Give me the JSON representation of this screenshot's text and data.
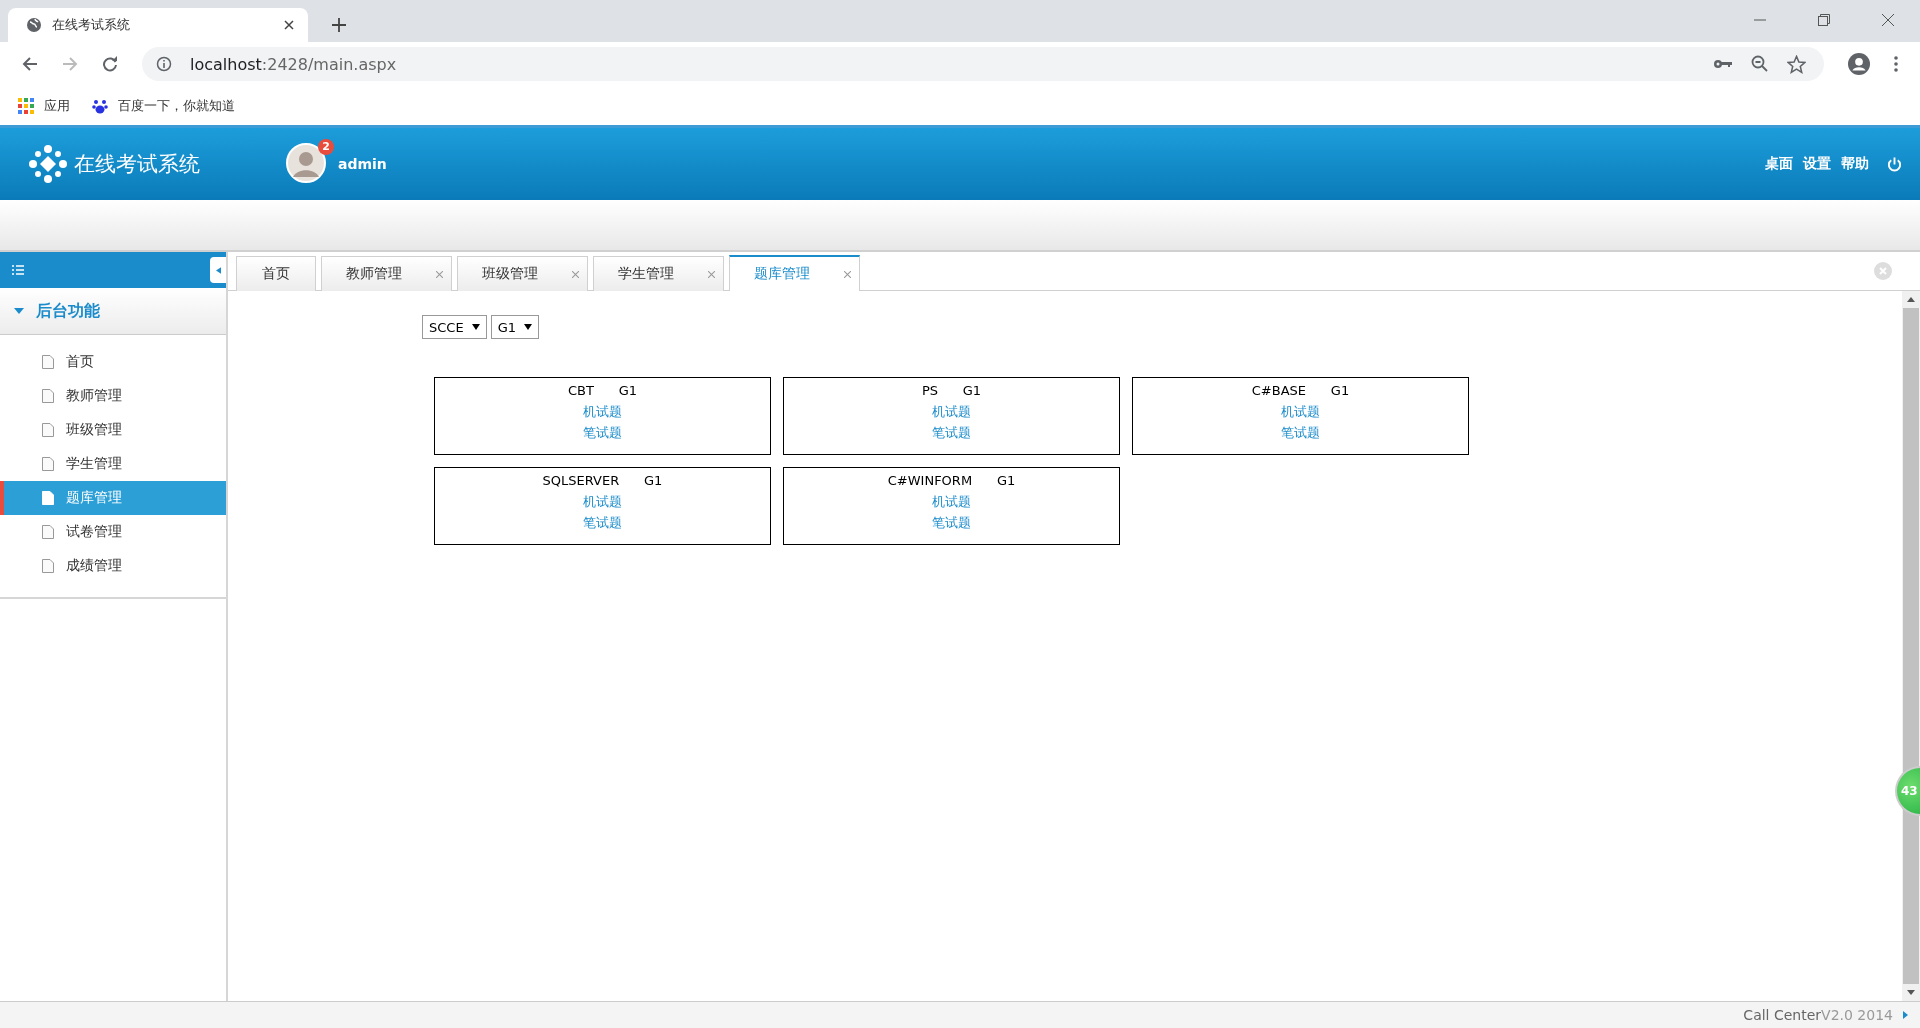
{
  "browser": {
    "tab_title": "在线考试系统",
    "url_host": "localhost",
    "url_rest": ":2428/main.aspx",
    "bookmarks": [
      {
        "kind": "apps",
        "label": "应用"
      },
      {
        "kind": "baidu",
        "label": "百度一下，你就知道"
      }
    ]
  },
  "header": {
    "app_title": "在线考试系统",
    "user": {
      "name": "admin",
      "badge": "2"
    },
    "links": [
      "桌面",
      "设置",
      "帮助"
    ]
  },
  "sidebar": {
    "section": {
      "label": "后台功能",
      "expanded": true
    },
    "items": [
      {
        "label": "首页",
        "selected": false
      },
      {
        "label": "教师管理",
        "selected": false
      },
      {
        "label": "班级管理",
        "selected": false
      },
      {
        "label": "学生管理",
        "selected": false
      },
      {
        "label": "题库管理",
        "selected": true
      },
      {
        "label": "试卷管理",
        "selected": false
      },
      {
        "label": "成绩管理",
        "selected": false
      }
    ]
  },
  "tabs": [
    {
      "label": "首页",
      "selected": false,
      "closable": false
    },
    {
      "label": "教师管理",
      "selected": false,
      "closable": true
    },
    {
      "label": "班级管理",
      "selected": false,
      "closable": true
    },
    {
      "label": "学生管理",
      "selected": false,
      "closable": true
    },
    {
      "label": "题库管理",
      "selected": true,
      "closable": true
    }
  ],
  "filters": [
    {
      "value": "SCCE"
    },
    {
      "value": "G1"
    }
  ],
  "cards": [
    {
      "subject": "CBT",
      "grade": "G1",
      "links": [
        "机试题",
        "笔试题"
      ]
    },
    {
      "subject": "PS",
      "grade": "G1",
      "links": [
        "机试题",
        "笔试题"
      ]
    },
    {
      "subject": "C#BASE",
      "grade": "G1",
      "links": [
        "机试题",
        "笔试题"
      ]
    },
    {
      "subject": "SQLSERVER",
      "grade": "G1",
      "links": [
        "机试题",
        "笔试题"
      ]
    },
    {
      "subject": "C#WINFORM",
      "grade": "G1",
      "links": [
        "机试题",
        "笔试题"
      ]
    }
  ],
  "floating_ball": "43",
  "footer": {
    "product": "Call Center",
    "version": "V2.0 2014"
  }
}
